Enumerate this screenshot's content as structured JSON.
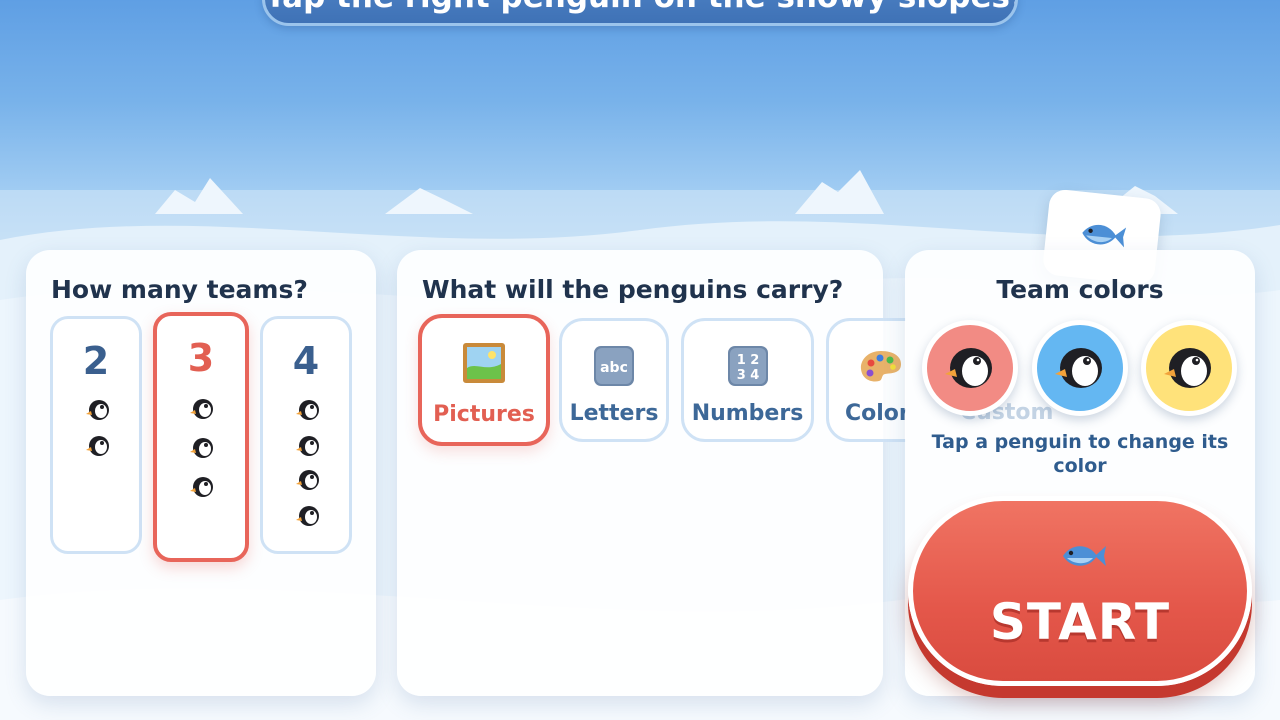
{
  "banner": {
    "text": "Tap the right penguin on the snowy slopes!"
  },
  "teams_panel": {
    "title": "How many teams?",
    "options": [
      {
        "label": "2",
        "penguins": 2,
        "selected": false
      },
      {
        "label": "3",
        "penguins": 3,
        "selected": true
      },
      {
        "label": "4",
        "penguins": 4,
        "selected": false
      }
    ]
  },
  "carry_panel": {
    "title": "What will the penguins carry?",
    "options": [
      {
        "label": "Pictures",
        "icon": "framed-picture-icon",
        "selected": true
      },
      {
        "label": "Letters",
        "icon": "abc-icon",
        "selected": false
      },
      {
        "label": "Numbers",
        "icon": "number-keycap-icon",
        "selected": false
      },
      {
        "label": "Colors",
        "icon": "palette-icon",
        "selected": false
      }
    ]
  },
  "colors_panel": {
    "title": "Team colors",
    "teams": [
      {
        "color": "#f28b84",
        "name": "red-team-penguin"
      },
      {
        "color": "#64b7f2",
        "name": "blue-team-penguin"
      },
      {
        "color": "#ffe27a",
        "name": "yellow-team-penguin"
      }
    ],
    "custom_label": "Custom",
    "hint": "Tap a penguin to change its color"
  },
  "start_button": {
    "label": "START",
    "icon": "fish-icon"
  },
  "floating_tile": {
    "icon": "fish-icon"
  },
  "colors": {
    "accent": "#e8655a",
    "card_border": "#cfe2f5",
    "text_dark": "#20334d",
    "text_blue": "#3d6898"
  }
}
